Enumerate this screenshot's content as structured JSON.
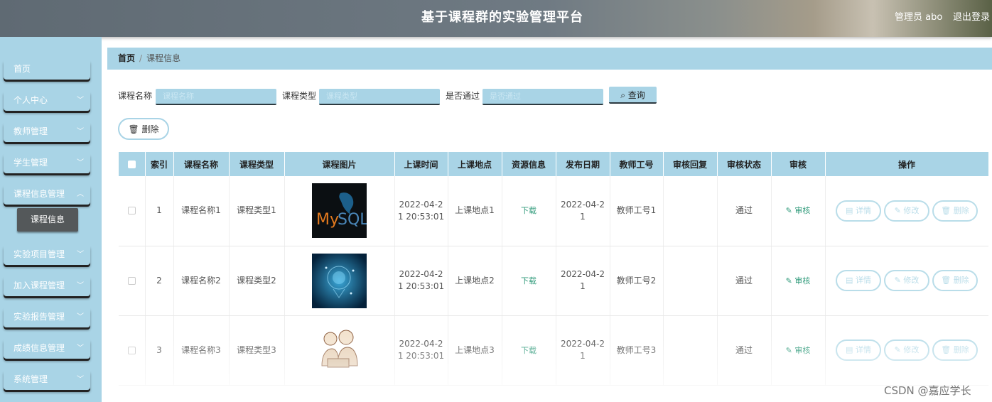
{
  "header": {
    "title": "基于课程群的实验管理平台",
    "user": "管理员 abo",
    "logout": "退出登录"
  },
  "sidebar": {
    "items": [
      {
        "label": "首页",
        "has_chevron": false
      },
      {
        "label": "个人中心",
        "has_chevron": true
      },
      {
        "label": "教师管理",
        "has_chevron": true
      },
      {
        "label": "学生管理",
        "has_chevron": true
      },
      {
        "label": "课程信息管理",
        "has_chevron": true
      },
      {
        "label": "实验项目管理",
        "has_chevron": true
      },
      {
        "label": "加入课程管理",
        "has_chevron": true
      },
      {
        "label": "实验报告管理",
        "has_chevron": true
      },
      {
        "label": "成绩信息管理",
        "has_chevron": true
      },
      {
        "label": "系统管理",
        "has_chevron": true
      }
    ],
    "active_sub": "课程信息"
  },
  "breadcrumb": {
    "home": "首页",
    "current": "课程信息"
  },
  "search": {
    "course_name_label": "课程名称",
    "course_name_placeholder": "课程名称",
    "course_type_label": "课程类型",
    "course_type_placeholder": "课程类型",
    "passed_label": "是否通过",
    "passed_placeholder": "是否通过",
    "query_button": "查询"
  },
  "actions": {
    "delete_button": "删除"
  },
  "table": {
    "columns": [
      "索引",
      "课程名称",
      "课程类型",
      "课程图片",
      "上课时间",
      "上课地点",
      "资源信息",
      "发布日期",
      "教师工号",
      "审核回复",
      "审核状态",
      "审核",
      "操作"
    ],
    "rows": [
      {
        "index": "1",
        "name": "课程名称1",
        "type": "课程类型1",
        "image": "mysql-logo",
        "time_a": "2022-04-2",
        "time_b": "1 20:53:01",
        "place": "上课地点1",
        "resource": "下载",
        "date_a": "2022-04-2",
        "date_b": "1",
        "teacher": "教师工号1",
        "reply": "",
        "status": "通过",
        "audit": "审核"
      },
      {
        "index": "2",
        "name": "课程名称2",
        "type": "课程类型2",
        "image": "ai-brain",
        "time_a": "2022-04-2",
        "time_b": "1 20:53:01",
        "place": "上课地点2",
        "resource": "下载",
        "date_a": "2022-04-2",
        "date_b": "1",
        "teacher": "教师工号2",
        "reply": "",
        "status": "通过",
        "audit": "审核"
      },
      {
        "index": "3",
        "name": "课程名称3",
        "type": "课程类型3",
        "image": "people-sketch",
        "time_a": "2022-04-2",
        "time_b": "1 20:53:01",
        "place": "上课地点3",
        "resource": "下载",
        "date_a": "2022-04-2",
        "date_b": "1",
        "teacher": "教师工号3",
        "reply": "",
        "status": "通过",
        "audit": "审核"
      }
    ],
    "op_buttons": {
      "detail": "详情",
      "edit": "修改",
      "delete": "删除"
    }
  },
  "watermark": "CSDN @嘉应学长",
  "colors": {
    "primary": "#a9d4e6",
    "link": "#2f9a7a",
    "submenu": "#54585a"
  }
}
